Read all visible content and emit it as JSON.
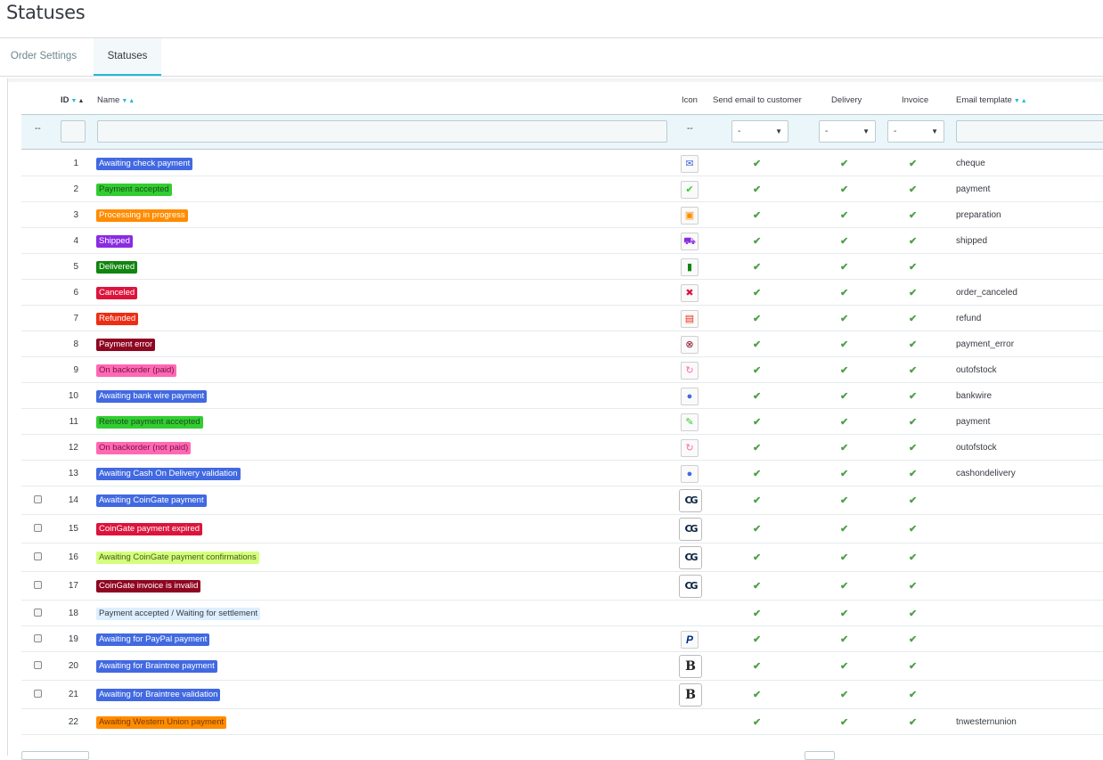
{
  "page": {
    "title": "Statuses"
  },
  "tabs": [
    {
      "label": "Order Settings",
      "active": false
    },
    {
      "label": "Statuses",
      "active": true
    }
  ],
  "columns": {
    "id": "ID",
    "name": "Name",
    "icon": "Icon",
    "send_email": "Send email to customer",
    "delivery": "Delivery",
    "invoice": "Invoice",
    "email_template": "Email template"
  },
  "filters": {
    "bulk_placeholder": "--",
    "icon_placeholder": "--",
    "send_email_value": "-",
    "delivery_value": "-",
    "invoice_value": "-"
  },
  "tick_glyph": "✔",
  "rows": [
    {
      "id": "1",
      "name": "Awaiting check payment",
      "color": "#4169e1",
      "text_color": "#ffffff",
      "icon": "check-payment-icon",
      "glyph": "✉",
      "template": "cheque",
      "checkbox": false
    },
    {
      "id": "2",
      "name": "Payment accepted",
      "color": "#32cd32",
      "text_color": "#1a4d1a",
      "icon": "checkmark-icon",
      "glyph": "✔",
      "template": "payment",
      "checkbox": false
    },
    {
      "id": "3",
      "name": "Processing in progress",
      "color": "#ff8c00",
      "text_color": "#ffffff",
      "icon": "package-icon",
      "glyph": "▣",
      "template": "preparation",
      "checkbox": false
    },
    {
      "id": "4",
      "name": "Shipped",
      "color": "#8a2be2",
      "text_color": "#ffffff",
      "icon": "truck-icon",
      "glyph": "⛟",
      "template": "shipped",
      "checkbox": false
    },
    {
      "id": "5",
      "name": "Delivered",
      "color": "#108510",
      "text_color": "#ffffff",
      "icon": "box-icon",
      "glyph": "▮",
      "template": "",
      "checkbox": false
    },
    {
      "id": "6",
      "name": "Canceled",
      "color": "#dc143c",
      "text_color": "#ffffff",
      "icon": "cross-icon",
      "glyph": "✖",
      "template": "order_canceled",
      "checkbox": false
    },
    {
      "id": "7",
      "name": "Refunded",
      "color": "#ec2e15",
      "text_color": "#ffffff",
      "icon": "money-icon",
      "glyph": "▤",
      "template": "refund",
      "checkbox": false
    },
    {
      "id": "8",
      "name": "Payment error",
      "color": "#8f0621",
      "text_color": "#ffffff",
      "icon": "error-icon",
      "glyph": "⊗",
      "template": "payment_error",
      "checkbox": false
    },
    {
      "id": "9",
      "name": "On backorder (paid)",
      "color": "#ff69b4",
      "text_color": "#7a1045",
      "icon": "refresh-icon",
      "glyph": "↻",
      "template": "outofstock",
      "checkbox": false
    },
    {
      "id": "10",
      "name": "Awaiting bank wire payment",
      "color": "#4169e1",
      "text_color": "#ffffff",
      "icon": "coins-icon",
      "glyph": "●",
      "template": "bankwire",
      "checkbox": false
    },
    {
      "id": "11",
      "name": "Remote payment accepted",
      "color": "#32cd32",
      "text_color": "#1a4d1a",
      "icon": "pen-icon",
      "glyph": "✎",
      "template": "payment",
      "checkbox": false
    },
    {
      "id": "12",
      "name": "On backorder (not paid)",
      "color": "#ff69b4",
      "text_color": "#7a1045",
      "icon": "refresh-icon",
      "glyph": "↻",
      "template": "outofstock",
      "checkbox": false
    },
    {
      "id": "13",
      "name": "Awaiting Cash On Delivery validation",
      "color": "#4169e1",
      "text_color": "#ffffff",
      "icon": "coins-icon",
      "glyph": "●",
      "template": "cashondelivery",
      "checkbox": false
    },
    {
      "id": "14",
      "name": "Awaiting CoinGate payment",
      "color": "#4169e1",
      "text_color": "#ffffff",
      "icon": "coingate-logo-icon",
      "glyph": "CG",
      "template": "",
      "checkbox": true
    },
    {
      "id": "15",
      "name": "CoinGate payment expired",
      "color": "#dc143c",
      "text_color": "#ffffff",
      "icon": "coingate-logo-icon",
      "glyph": "CG",
      "template": "",
      "checkbox": true
    },
    {
      "id": "16",
      "name": "Awaiting CoinGate payment confirmations",
      "color": "#d4ff7e",
      "text_color": "#4a5a1a",
      "icon": "coingate-logo-icon",
      "glyph": "CG",
      "template": "",
      "checkbox": true
    },
    {
      "id": "17",
      "name": "CoinGate invoice is invalid",
      "color": "#8f0621",
      "text_color": "#ffffff",
      "icon": "coingate-logo-icon",
      "glyph": "CG",
      "template": "",
      "checkbox": true
    },
    {
      "id": "18",
      "name": "Payment accepted / Waiting for settlement",
      "color": "#ddeeff",
      "text_color": "#363a41",
      "icon": "",
      "glyph": "",
      "template": "",
      "checkbox": true
    },
    {
      "id": "19",
      "name": "Awaiting for PayPal payment",
      "color": "#4169e1",
      "text_color": "#ffffff",
      "icon": "paypal-icon",
      "glyph": "P",
      "template": "",
      "checkbox": true
    },
    {
      "id": "20",
      "name": "Awaiting for Braintree payment",
      "color": "#4169e1",
      "text_color": "#ffffff",
      "icon": "braintree-icon",
      "glyph": "B",
      "template": "",
      "checkbox": true
    },
    {
      "id": "21",
      "name": "Awaiting for Braintree validation",
      "color": "#4169e1",
      "text_color": "#ffffff",
      "icon": "braintree-icon",
      "glyph": "B",
      "template": "",
      "checkbox": true
    },
    {
      "id": "22",
      "name": "Awaiting Western Union payment",
      "color": "#ff8c00",
      "text_color": "#7a3a00",
      "icon": "",
      "glyph": "",
      "template": "tnwesternunion",
      "checkbox": false
    }
  ]
}
